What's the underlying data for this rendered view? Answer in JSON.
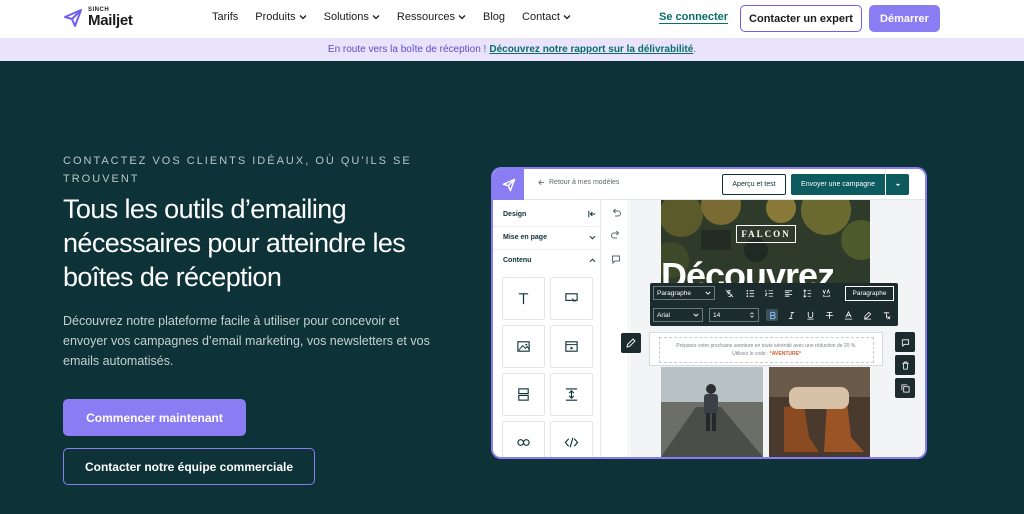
{
  "nav": {
    "logo_sinch": "SINCH",
    "logo_mailjet": "Mailjet",
    "menu": [
      {
        "label": "Tarifs",
        "dropdown": false
      },
      {
        "label": "Produits",
        "dropdown": true
      },
      {
        "label": "Solutions",
        "dropdown": true
      },
      {
        "label": "Ressources",
        "dropdown": true
      },
      {
        "label": "Blog",
        "dropdown": false
      },
      {
        "label": "Contact",
        "dropdown": true
      }
    ],
    "login": "Se connecter",
    "expert": "Contacter un expert",
    "start": "Démarrer"
  },
  "banner": {
    "text": "En route vers la boîte de réception !",
    "link": "Découvrez notre rapport sur la délivrabilité",
    "suffix": "."
  },
  "hero": {
    "eyebrow": "CONTACTEZ VOS CLIENTS IDÉAUX, OÙ QU'ILS SE TROUVENT",
    "headline": "Tous les outils d’emailing nécessaires pour atteindre les boîtes de réception",
    "description": "Découvrez notre plateforme facile à utiliser pour concevoir et envoyer vos campagnes d’email marketing, vos newsletters et vos emails automatisés.",
    "cta_primary": "Commencer maintenant",
    "cta_secondary": "Contacter notre équipe commerciale"
  },
  "editor": {
    "back": "Retour à mes modèles",
    "preview": "Aperçu et test",
    "send": "Envoyer une campagne",
    "sidebar": {
      "design": "Design",
      "layout": "Mise en page",
      "content": "Contenu"
    },
    "toolbar": {
      "paragraph_select": "Paragraphe",
      "font_select": "Arial",
      "size_select": "14",
      "paragraph_button": "Paragraphe"
    },
    "email": {
      "brand": "FALCON",
      "headline": "Découvrez",
      "body": "Préparez votre prochaine aventure en toute sérénité avec une réduction de 20 %.",
      "code_prefix": "Utilisez le code :",
      "code": "*AVENTURE*"
    }
  },
  "colors": {
    "background": "#0d3238",
    "accent": "#8a7df3",
    "teal": "#0b6c6c",
    "banner": "#e9e3fb"
  }
}
